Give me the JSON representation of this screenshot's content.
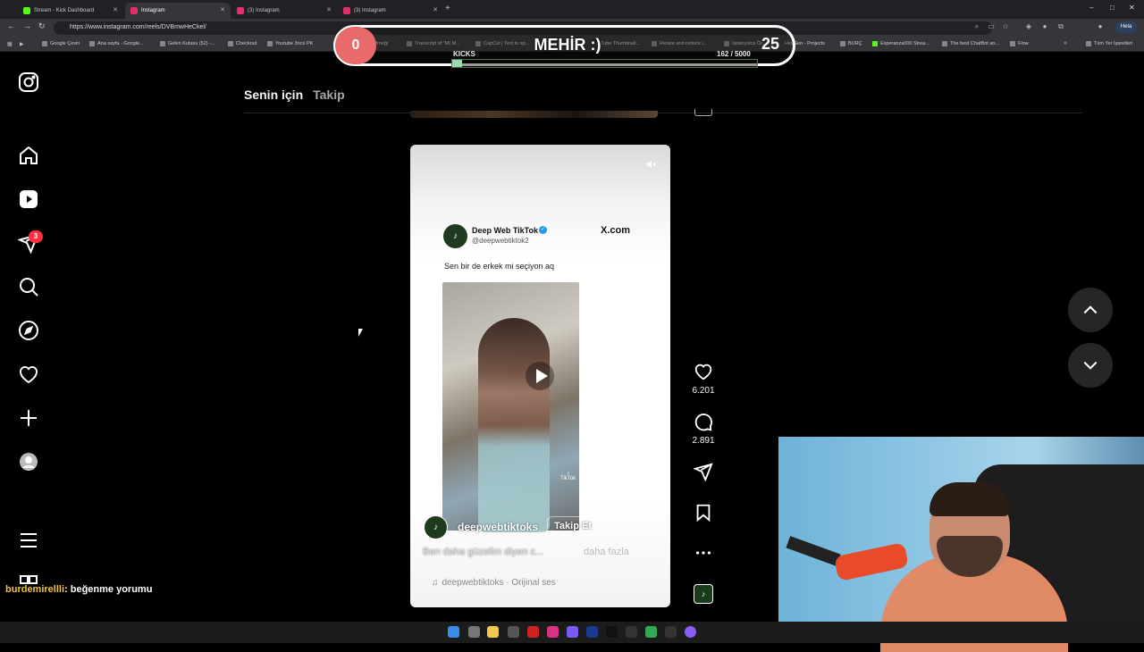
{
  "browser": {
    "tabs": [
      {
        "label": "Stream - Kick Dashboard",
        "active": false,
        "color": "#53fc18"
      },
      {
        "label": "Instagram",
        "active": true,
        "color": "#e1306c"
      },
      {
        "label": "(3) Instagram",
        "active": false,
        "color": "#e1306c"
      },
      {
        "label": "(3) Instagram",
        "active": false,
        "color": "#e1306c"
      }
    ],
    "url": "https://www.instagram.com/reels/DVBmwHeCkel/",
    "profile_label": "Hela",
    "bookmarks": [
      "Google Çeviri",
      "Ana sayfa - Google...",
      "Gelen Kutusu (52) -...",
      "Checkout",
      "Youtube 3ncü PK",
      "ng Örneği",
      "Transcript of \"MI M...",
      "CapCut | Text to sp...",
      "Tube Thumbnail...",
      "Resize and reduce i...",
      "İspanyolca Ör...",
      "HeyGen - Projects",
      "BURÇ",
      "Esperanza000 Strea...",
      "The best ChatBot an...",
      "Flow",
      "Tüm Yer İşaretleri"
    ]
  },
  "overlay": {
    "left_count": "0",
    "title": "MEHİR :)",
    "right_count": "25",
    "label": "KICKS",
    "progress_text": "162  / 5000",
    "progress_value": 162,
    "progress_max": 5000
  },
  "instagram": {
    "nav": [
      {
        "name": "instagram-logo-icon"
      },
      {
        "name": "home-icon"
      },
      {
        "name": "reels-icon"
      },
      {
        "name": "messages-icon"
      },
      {
        "name": "search-icon"
      },
      {
        "name": "explore-icon"
      },
      {
        "name": "notifications-icon"
      },
      {
        "name": "create-icon"
      },
      {
        "name": "profile-icon"
      },
      {
        "name": "more-menu-icon"
      }
    ],
    "messages_badge": "3",
    "feed_tabs": {
      "for_you": "Senin için",
      "following": "Takip"
    },
    "reel": {
      "tweet_name": "Deep Web TikTok",
      "tweet_handle": "@deepwebtiktok2",
      "tweet_source": "X.com",
      "tweet_text": "Sen bir de erkek mi seçiyon aq",
      "watermark": "TikTok",
      "author": "deepwebtiktoks",
      "follow_label": "Takip Et",
      "caption": "Ben daha güzelim diyen c...",
      "caption_more": "daha fazla",
      "audio": "deepwebtiktoks · Orijinal ses"
    },
    "actions": {
      "likes": "6.201",
      "comments": "2.891"
    }
  },
  "chat": {
    "user": "burdemirellli",
    "message": ": beğenme yorumu"
  }
}
